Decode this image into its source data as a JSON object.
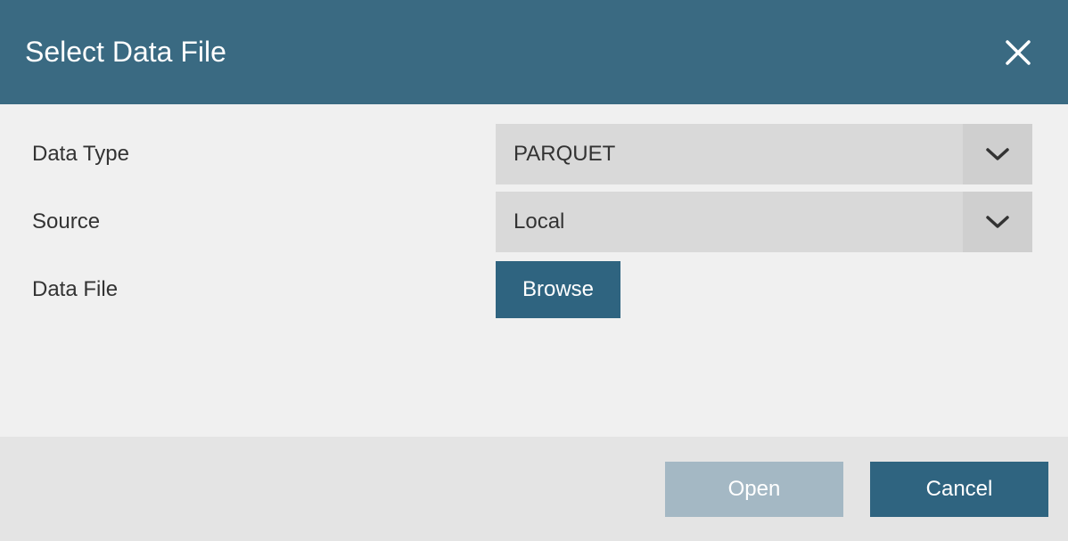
{
  "header": {
    "title": "Select Data File"
  },
  "form": {
    "dataType": {
      "label": "Data Type",
      "value": "PARQUET"
    },
    "source": {
      "label": "Source",
      "value": "Local"
    },
    "dataFile": {
      "label": "Data File",
      "browseLabel": "Browse"
    }
  },
  "footer": {
    "openLabel": "Open",
    "cancelLabel": "Cancel"
  }
}
